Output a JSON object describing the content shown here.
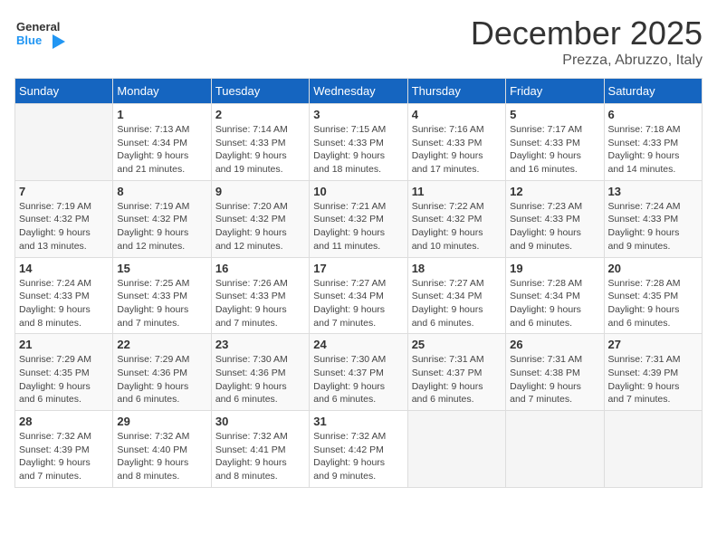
{
  "header": {
    "logo_general": "General",
    "logo_blue": "Blue",
    "month_title": "December 2025",
    "location": "Prezza, Abruzzo, Italy"
  },
  "columns": [
    "Sunday",
    "Monday",
    "Tuesday",
    "Wednesday",
    "Thursday",
    "Friday",
    "Saturday"
  ],
  "weeks": [
    [
      {
        "day": "",
        "info": ""
      },
      {
        "day": "1",
        "info": "Sunrise: 7:13 AM\nSunset: 4:34 PM\nDaylight: 9 hours\nand 21 minutes."
      },
      {
        "day": "2",
        "info": "Sunrise: 7:14 AM\nSunset: 4:33 PM\nDaylight: 9 hours\nand 19 minutes."
      },
      {
        "day": "3",
        "info": "Sunrise: 7:15 AM\nSunset: 4:33 PM\nDaylight: 9 hours\nand 18 minutes."
      },
      {
        "day": "4",
        "info": "Sunrise: 7:16 AM\nSunset: 4:33 PM\nDaylight: 9 hours\nand 17 minutes."
      },
      {
        "day": "5",
        "info": "Sunrise: 7:17 AM\nSunset: 4:33 PM\nDaylight: 9 hours\nand 16 minutes."
      },
      {
        "day": "6",
        "info": "Sunrise: 7:18 AM\nSunset: 4:33 PM\nDaylight: 9 hours\nand 14 minutes."
      }
    ],
    [
      {
        "day": "7",
        "info": "Sunrise: 7:19 AM\nSunset: 4:32 PM\nDaylight: 9 hours\nand 13 minutes."
      },
      {
        "day": "8",
        "info": "Sunrise: 7:19 AM\nSunset: 4:32 PM\nDaylight: 9 hours\nand 12 minutes."
      },
      {
        "day": "9",
        "info": "Sunrise: 7:20 AM\nSunset: 4:32 PM\nDaylight: 9 hours\nand 12 minutes."
      },
      {
        "day": "10",
        "info": "Sunrise: 7:21 AM\nSunset: 4:32 PM\nDaylight: 9 hours\nand 11 minutes."
      },
      {
        "day": "11",
        "info": "Sunrise: 7:22 AM\nSunset: 4:32 PM\nDaylight: 9 hours\nand 10 minutes."
      },
      {
        "day": "12",
        "info": "Sunrise: 7:23 AM\nSunset: 4:33 PM\nDaylight: 9 hours\nand 9 minutes."
      },
      {
        "day": "13",
        "info": "Sunrise: 7:24 AM\nSunset: 4:33 PM\nDaylight: 9 hours\nand 9 minutes."
      }
    ],
    [
      {
        "day": "14",
        "info": "Sunrise: 7:24 AM\nSunset: 4:33 PM\nDaylight: 9 hours\nand 8 minutes."
      },
      {
        "day": "15",
        "info": "Sunrise: 7:25 AM\nSunset: 4:33 PM\nDaylight: 9 hours\nand 7 minutes."
      },
      {
        "day": "16",
        "info": "Sunrise: 7:26 AM\nSunset: 4:33 PM\nDaylight: 9 hours\nand 7 minutes."
      },
      {
        "day": "17",
        "info": "Sunrise: 7:27 AM\nSunset: 4:34 PM\nDaylight: 9 hours\nand 7 minutes."
      },
      {
        "day": "18",
        "info": "Sunrise: 7:27 AM\nSunset: 4:34 PM\nDaylight: 9 hours\nand 6 minutes."
      },
      {
        "day": "19",
        "info": "Sunrise: 7:28 AM\nSunset: 4:34 PM\nDaylight: 9 hours\nand 6 minutes."
      },
      {
        "day": "20",
        "info": "Sunrise: 7:28 AM\nSunset: 4:35 PM\nDaylight: 9 hours\nand 6 minutes."
      }
    ],
    [
      {
        "day": "21",
        "info": "Sunrise: 7:29 AM\nSunset: 4:35 PM\nDaylight: 9 hours\nand 6 minutes."
      },
      {
        "day": "22",
        "info": "Sunrise: 7:29 AM\nSunset: 4:36 PM\nDaylight: 9 hours\nand 6 minutes."
      },
      {
        "day": "23",
        "info": "Sunrise: 7:30 AM\nSunset: 4:36 PM\nDaylight: 9 hours\nand 6 minutes."
      },
      {
        "day": "24",
        "info": "Sunrise: 7:30 AM\nSunset: 4:37 PM\nDaylight: 9 hours\nand 6 minutes."
      },
      {
        "day": "25",
        "info": "Sunrise: 7:31 AM\nSunset: 4:37 PM\nDaylight: 9 hours\nand 6 minutes."
      },
      {
        "day": "26",
        "info": "Sunrise: 7:31 AM\nSunset: 4:38 PM\nDaylight: 9 hours\nand 7 minutes."
      },
      {
        "day": "27",
        "info": "Sunrise: 7:31 AM\nSunset: 4:39 PM\nDaylight: 9 hours\nand 7 minutes."
      }
    ],
    [
      {
        "day": "28",
        "info": "Sunrise: 7:32 AM\nSunset: 4:39 PM\nDaylight: 9 hours\nand 7 minutes."
      },
      {
        "day": "29",
        "info": "Sunrise: 7:32 AM\nSunset: 4:40 PM\nDaylight: 9 hours\nand 8 minutes."
      },
      {
        "day": "30",
        "info": "Sunrise: 7:32 AM\nSunset: 4:41 PM\nDaylight: 9 hours\nand 8 minutes."
      },
      {
        "day": "31",
        "info": "Sunrise: 7:32 AM\nSunset: 4:42 PM\nDaylight: 9 hours\nand 9 minutes."
      },
      {
        "day": "",
        "info": ""
      },
      {
        "day": "",
        "info": ""
      },
      {
        "day": "",
        "info": ""
      }
    ]
  ]
}
